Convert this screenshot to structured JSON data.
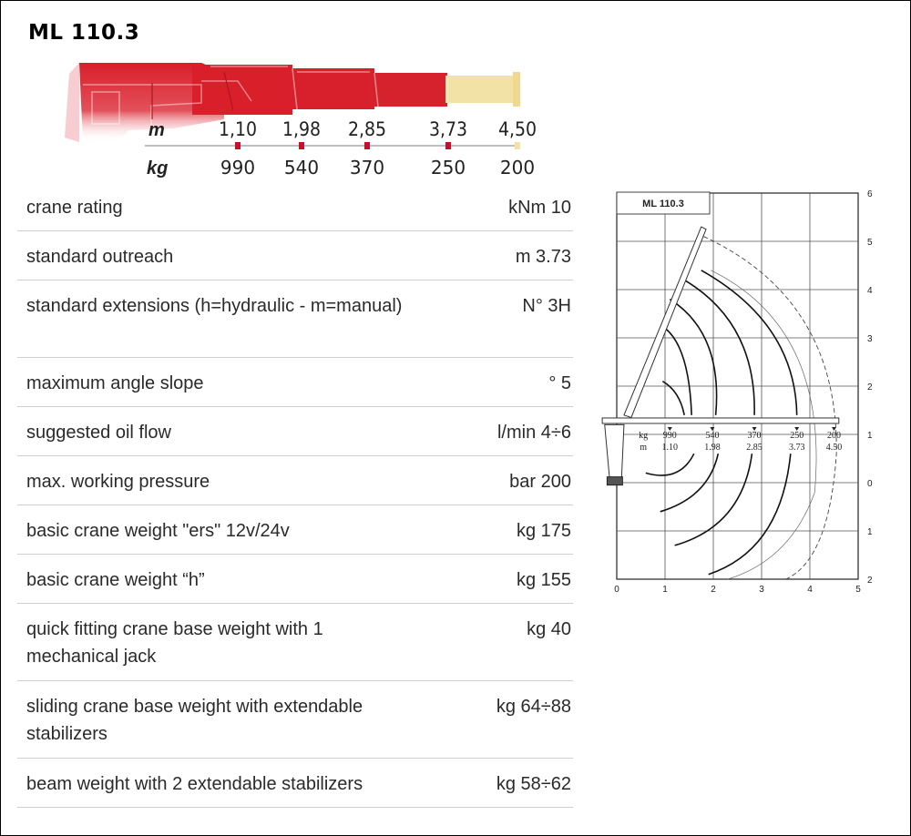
{
  "model": "ML 110.3",
  "boom": {
    "unit_m": "m",
    "unit_kg": "kg",
    "points": [
      {
        "m": "1,10",
        "kg": "990"
      },
      {
        "m": "1,98",
        "kg": "540"
      },
      {
        "m": "2,85",
        "kg": "370"
      },
      {
        "m": "3,73",
        "kg": "250"
      },
      {
        "m": "4,50",
        "kg": "200"
      }
    ]
  },
  "specs": [
    {
      "label": "crane rating",
      "value": "kNm 10"
    },
    {
      "label": "standard outreach",
      "value": "m 3.73"
    },
    {
      "label": "standard extensions (h=hydraulic - m=manual)",
      "value": "N° 3H"
    },
    {
      "label": "maximum angle slope",
      "value": "° 5"
    },
    {
      "label": "suggested oil flow",
      "value": "l/min 4÷6"
    },
    {
      "label": "max. working pressure",
      "value": "bar 200"
    },
    {
      "label": "basic crane weight \"ers\" 12v/24v",
      "value": "kg 175"
    },
    {
      "label": "basic crane weight “h”",
      "value": "kg 155"
    },
    {
      "label": "quick fitting crane base weight with 1 mechanical jack",
      "value": "kg 40"
    },
    {
      "label": "sliding crane base weight with extendable stabilizers",
      "value": "kg 64÷88"
    },
    {
      "label": "beam weight with 2 extendable stabilizers",
      "value": "kg 58÷62"
    }
  ],
  "diagram": {
    "title": "ML 110.3",
    "x_ticks": [
      "0",
      "1",
      "2",
      "3",
      "4",
      "5"
    ],
    "y_ticks": [
      "6",
      "5",
      "4",
      "3",
      "2",
      "1",
      "0",
      "1",
      "2"
    ],
    "label_kg": "kg",
    "label_m": "m",
    "loads": [
      {
        "kg": "990",
        "m": "1.10"
      },
      {
        "kg": "540",
        "m": "1.98"
      },
      {
        "kg": "370",
        "m": "2.85"
      },
      {
        "kg": "250",
        "m": "3.73"
      },
      {
        "kg": "200",
        "m": "4.50"
      }
    ]
  },
  "colors": {
    "boom_red": "#d81f2a",
    "boom_manual": "#f3e2a6",
    "tick_red": "#c8102e"
  }
}
